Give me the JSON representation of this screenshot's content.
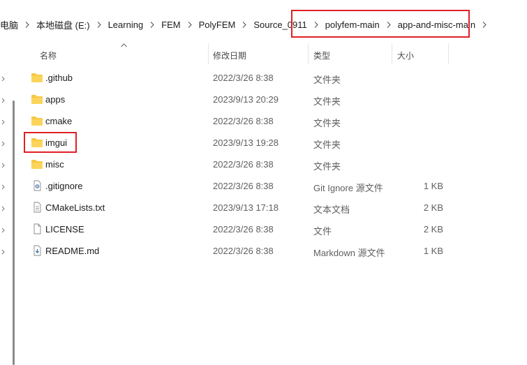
{
  "breadcrumb": {
    "items": [
      "电脑",
      "本地磁盘 (E:)",
      "Learning",
      "FEM",
      "PolyFEM",
      "Source_0911",
      "polyfem-main",
      "app-and-misc-main"
    ]
  },
  "columns": {
    "name": "名称",
    "date": "修改日期",
    "type": "类型",
    "size": "大小"
  },
  "files": [
    {
      "name": ".github",
      "date": "2022/3/26 8:38",
      "type": "文件夹",
      "size": "",
      "icon": "folder-icon"
    },
    {
      "name": "apps",
      "date": "2023/9/13 20:29",
      "type": "文件夹",
      "size": "",
      "icon": "folder-icon"
    },
    {
      "name": "cmake",
      "date": "2022/3/26 8:38",
      "type": "文件夹",
      "size": "",
      "icon": "folder-icon"
    },
    {
      "name": "imgui",
      "date": "2023/9/13 19:28",
      "type": "文件夹",
      "size": "",
      "icon": "folder-icon"
    },
    {
      "name": "misc",
      "date": "2022/3/26 8:38",
      "type": "文件夹",
      "size": "",
      "icon": "folder-icon"
    },
    {
      "name": ".gitignore",
      "date": "2022/3/26 8:38",
      "type": "Git Ignore 源文件",
      "size": "1 KB",
      "icon": "config-file-icon"
    },
    {
      "name": "CMakeLists.txt",
      "date": "2023/9/13 17:18",
      "type": "文本文档",
      "size": "2 KB",
      "icon": "text-file-icon"
    },
    {
      "name": "LICENSE",
      "date": "2022/3/26 8:38",
      "type": "文件",
      "size": "2 KB",
      "icon": "file-icon"
    },
    {
      "name": "README.md",
      "date": "2022/3/26 8:38",
      "type": "Markdown 源文件",
      "size": "1 KB",
      "icon": "markdown-file-icon"
    }
  ],
  "colors": {
    "highlight": "#e01f26",
    "folder": "#f7c843"
  }
}
